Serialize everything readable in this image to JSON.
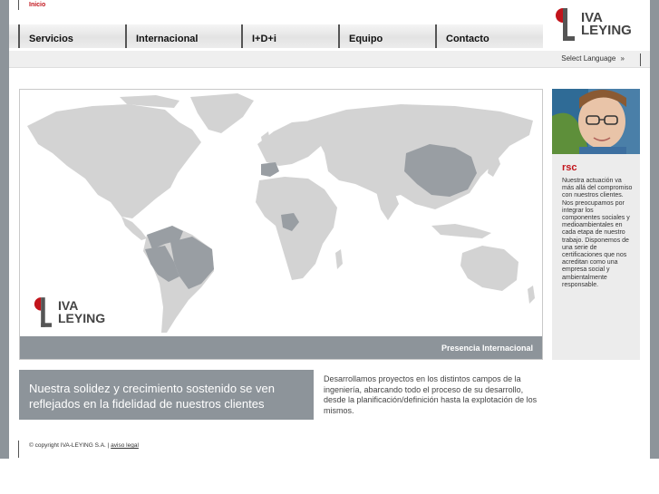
{
  "breadcrumb": {
    "home": "Inicio"
  },
  "nav": {
    "items": [
      {
        "label": "Servicios"
      },
      {
        "label": "Internacional"
      },
      {
        "label": "I+D+i"
      },
      {
        "label": "Equipo"
      },
      {
        "label": "Contacto"
      }
    ]
  },
  "logo": {
    "line1": "IVA",
    "line2": "LEYING"
  },
  "language": {
    "label": "Select Language",
    "chevron": "»"
  },
  "map": {
    "caption": "Presencia Internacional",
    "highlighted_countries": [
      "Spain",
      "China",
      "Nigeria",
      "Venezuela",
      "Colombia",
      "Ecuador",
      "Peru",
      "Bolivia",
      "Brazil"
    ],
    "colors": {
      "land": "#d3d3d3",
      "highlight": "#999ea3",
      "caption_bg": "#8d949a"
    }
  },
  "sidebar": {
    "photo_icon": "child-with-glasses-photo",
    "title": "rsc",
    "text": "Nuestra actuación va más allá del compromiso con nuestros clientes. Nos preocupamos por integrar los componentes sociales y medioambientales en cada etapa de nuestro trabajo. Disponemos de una serie de certificaciones que nos acreditan como una empresa social y ambientalmente responsable."
  },
  "tagline": "Nuestra solidez y crecimiento sostenido se ven reflejados en la fidelidad de nuestros clientes",
  "description": "Desarrollamos proyectos en los distintos campos de la ingeniería, abarcando todo el proceso de su desarrollo, desde la planificación/definición hasta la explotación de los mismos.",
  "footer": {
    "copyright": "© copyright IVA-LEYING S.A. | ",
    "legal": "aviso legal"
  },
  "colors": {
    "accent_red": "#c2141b",
    "gray": "#8d949a"
  }
}
